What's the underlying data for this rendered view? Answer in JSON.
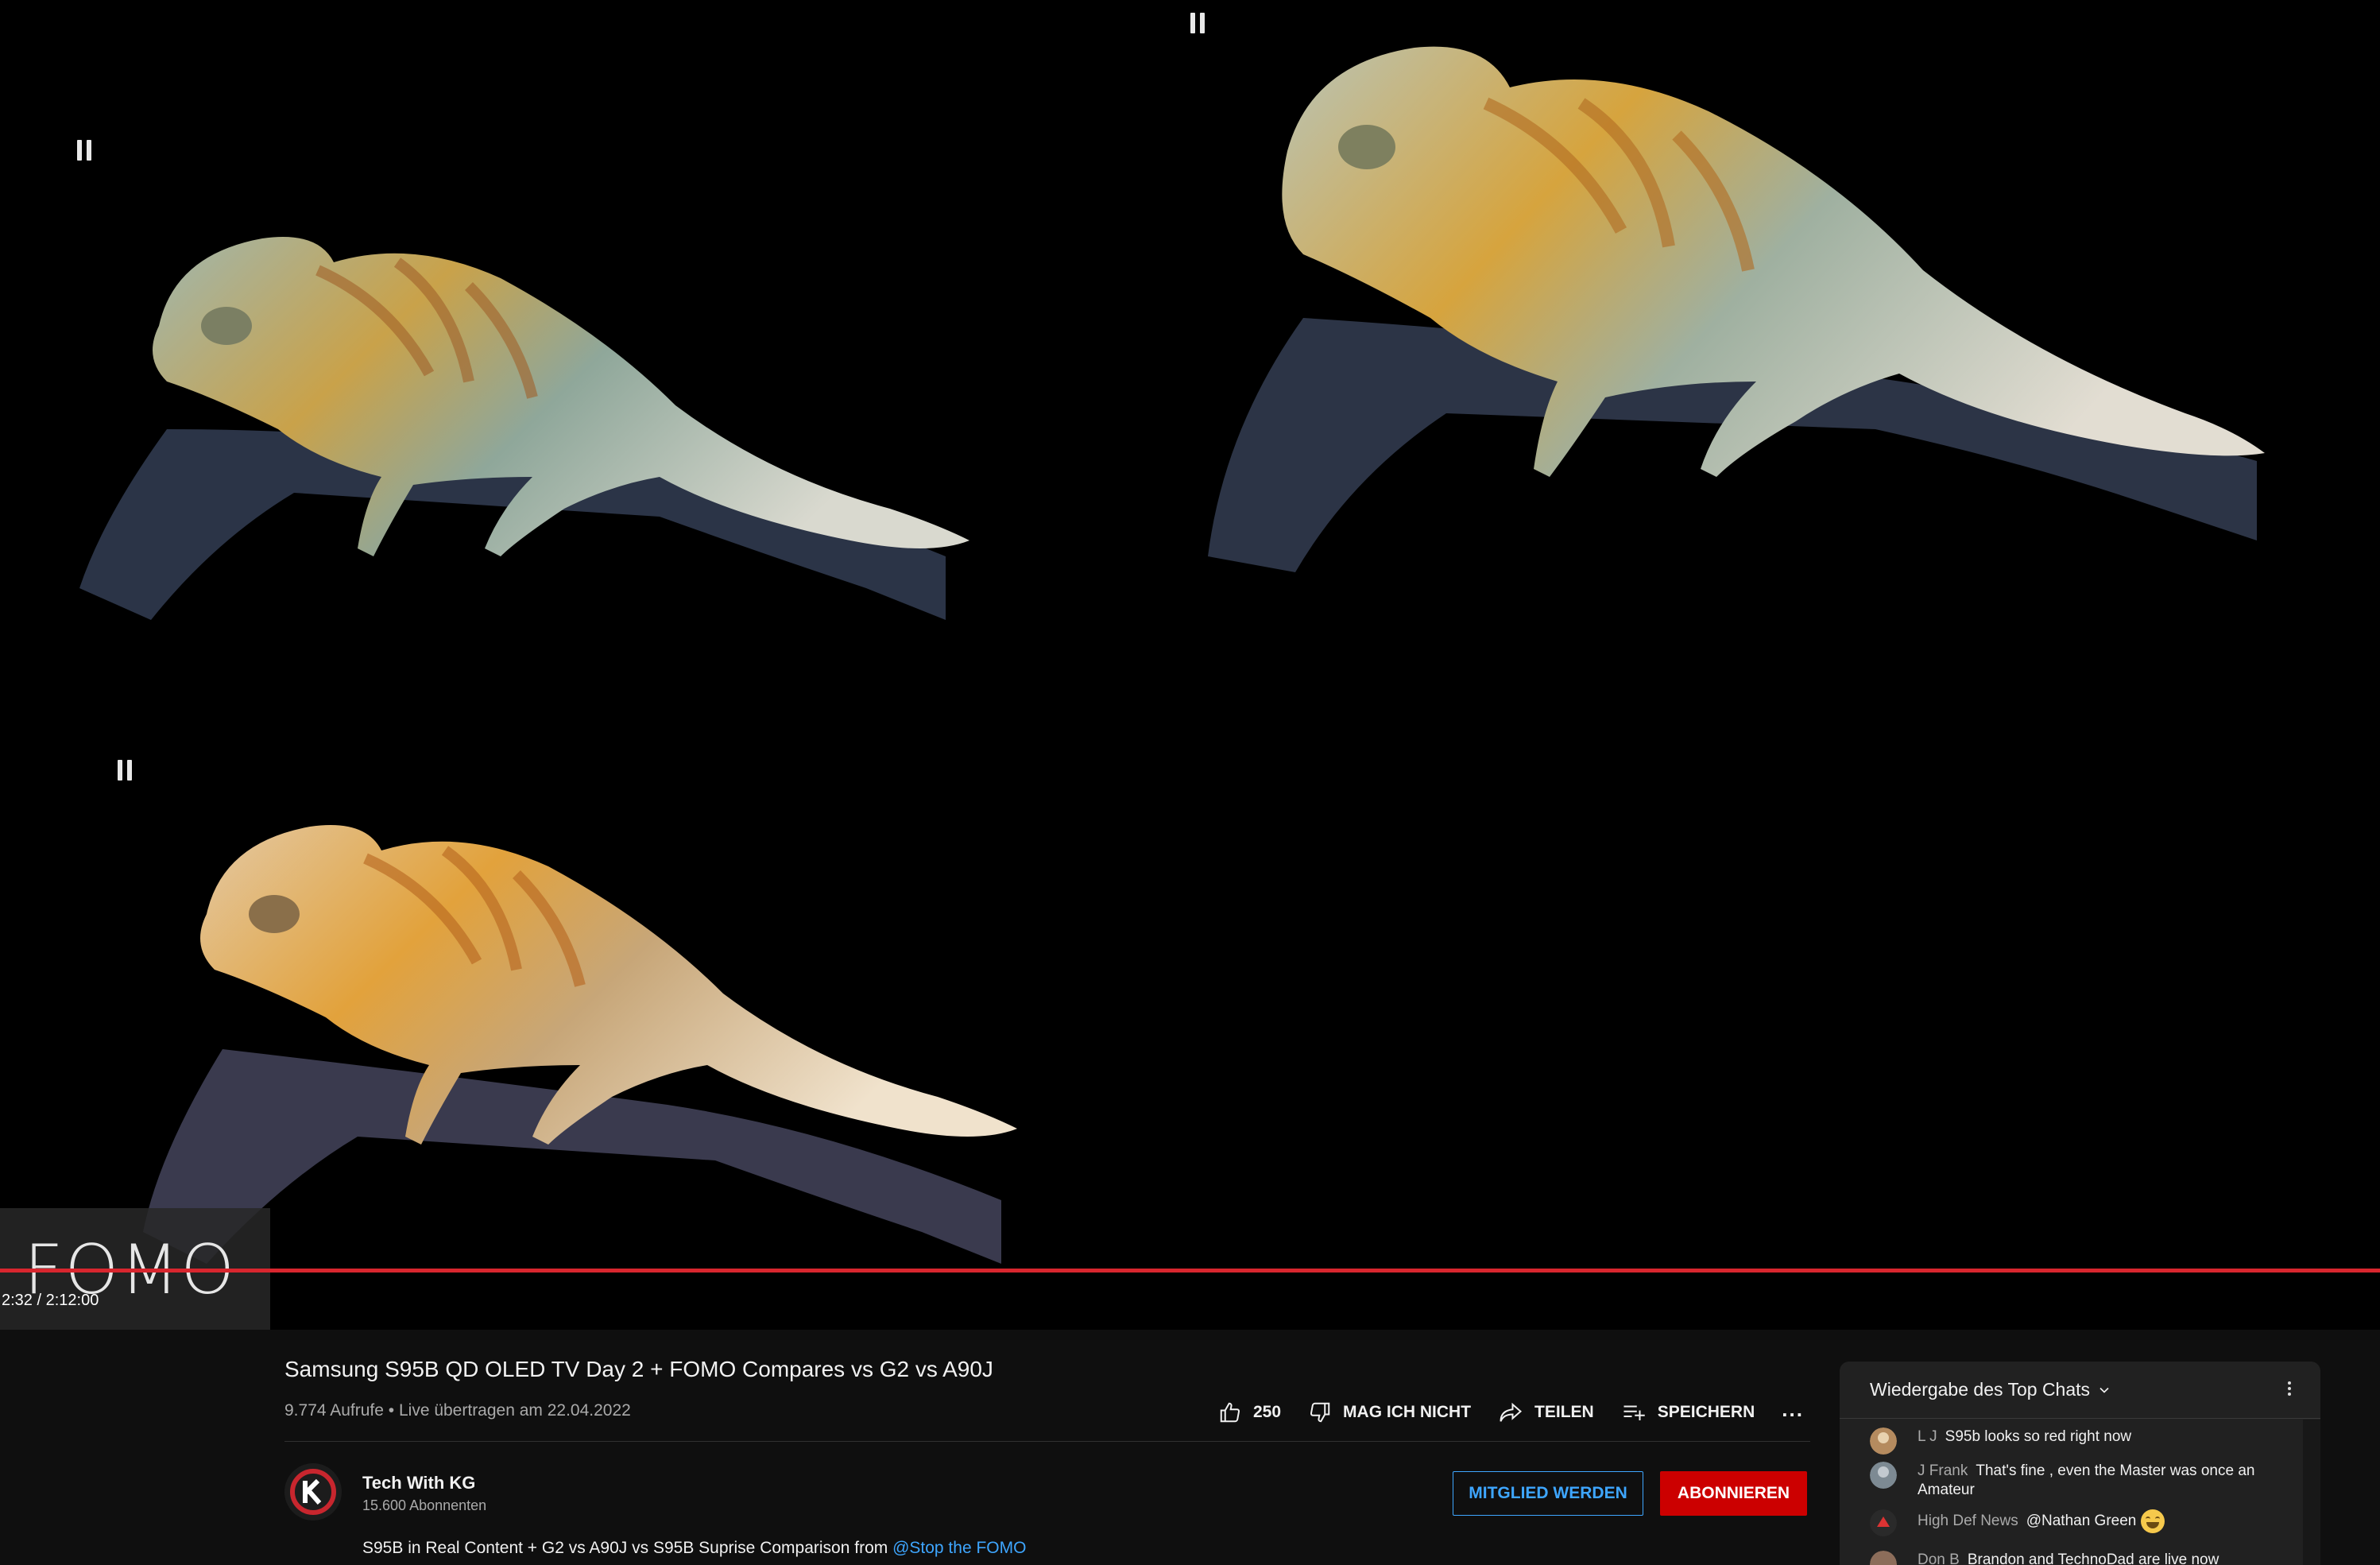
{
  "player": {
    "overlay_text": "FOMO",
    "time_display": "2:32 / 2:12:00",
    "progress_fraction": 1.0,
    "progress_color": "#d8262e"
  },
  "video": {
    "title": "Samsung S95B QD OLED TV Day 2 + FOMO Compares vs G2 vs A90J",
    "views": "9.774 Aufrufe",
    "separator": " • ",
    "live_info": "Live übertragen am 22.04.2022"
  },
  "actions": {
    "like_count": "250",
    "dislike_label": "MAG ICH NICHT",
    "share_label": "TEILEN",
    "save_label": "SPEICHERN",
    "more_label": "..."
  },
  "channel": {
    "name": "Tech With KG",
    "subscribers": "15.600 Abonnenten",
    "member_button": "MITGLIED WERDEN",
    "subscribe_button": "ABONNIEREN"
  },
  "description": {
    "text": "S95B in Real Content + G2 vs A90J vs S95B Suprise Comparison from ",
    "link": "@Stop the FOMO"
  },
  "chat": {
    "title": "Wiedergabe des Top Chats",
    "messages": [
      {
        "author": "L J",
        "text": "S95b looks so red right now"
      },
      {
        "author": "J Frank",
        "text": "That's fine , even the Master was once an Amateur"
      },
      {
        "author": "High Def News",
        "text": "@Nathan Green"
      },
      {
        "author": "Don B",
        "text": "Brandon and TechnoDad are live now"
      }
    ]
  },
  "colors": {
    "accent_blue": "#3ea6ff",
    "subscribe_red": "#cc0000",
    "background": "#0f0f0f"
  }
}
